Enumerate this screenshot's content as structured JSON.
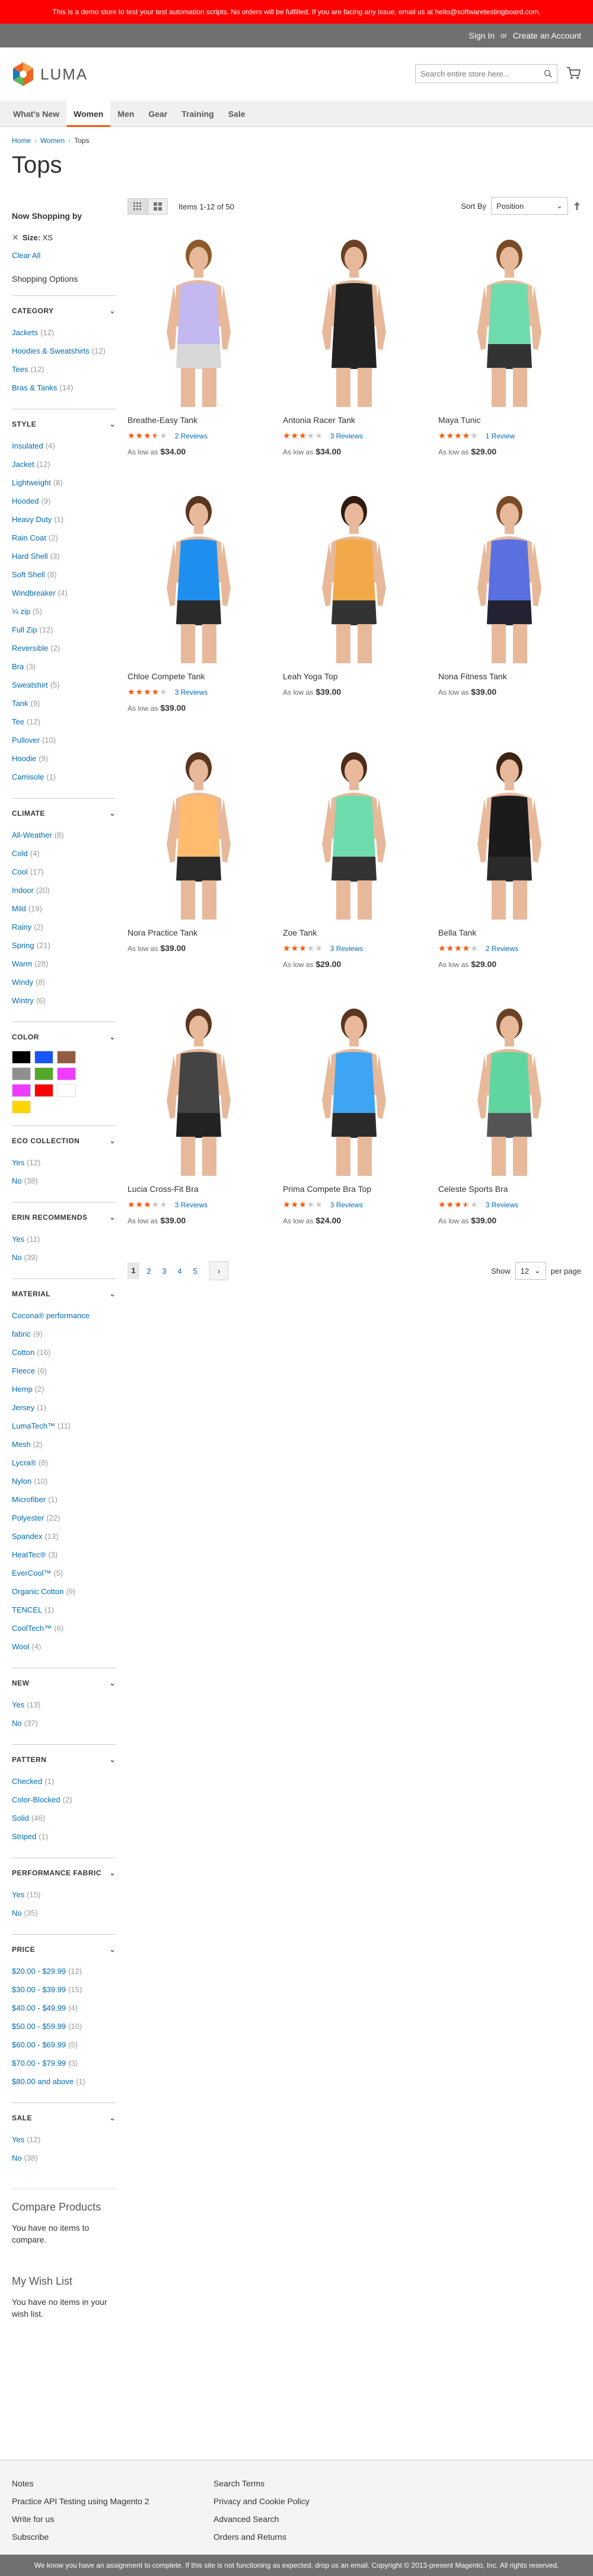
{
  "demo_notice": "This is a demo store to test your test automation scripts. No orders will be fulfilled. If you are facing any issue, email us at hello@softwaretestingboard.com.",
  "header_links": {
    "sign_in": "Sign In",
    "or": "or",
    "create_account": "Create an Account"
  },
  "logo_text": "LUMA",
  "search": {
    "placeholder": "Search entire store here..."
  },
  "nav": [
    "What's New",
    "Women",
    "Men",
    "Gear",
    "Training",
    "Sale"
  ],
  "breadcrumb": [
    "Home",
    "Women",
    "Tops"
  ],
  "page_title": "Tops",
  "now_shopping": {
    "title": "Now Shopping by",
    "filter_label": "Size:",
    "filter_value": "XS",
    "clear_all": "Clear All"
  },
  "shopping_options": "Shopping Options",
  "facets": [
    {
      "title": "CATEGORY",
      "items": [
        {
          "label": "Jackets",
          "count": "(12)"
        },
        {
          "label": "Hoodies & Sweatshirts",
          "count": "(12)"
        },
        {
          "label": "Tees",
          "count": "(12)"
        },
        {
          "label": "Bras & Tanks",
          "count": "(14)"
        }
      ]
    },
    {
      "title": "STYLE",
      "items": [
        {
          "label": "Insulated",
          "count": "(4)"
        },
        {
          "label": "Jacket",
          "count": "(12)"
        },
        {
          "label": "Lightweight",
          "count": "(8)"
        },
        {
          "label": "Hooded",
          "count": "(9)"
        },
        {
          "label": "Heavy Duty",
          "count": "(1)"
        },
        {
          "label": "Rain Coat",
          "count": "(2)"
        },
        {
          "label": "Hard Shell",
          "count": "(3)"
        },
        {
          "label": "Soft Shell",
          "count": "(8)"
        },
        {
          "label": "Windbreaker",
          "count": "(4)"
        },
        {
          "label": "¼ zip",
          "count": "(5)"
        },
        {
          "label": "Full Zip",
          "count": "(12)"
        },
        {
          "label": "Reversible",
          "count": "(2)"
        },
        {
          "label": "Bra",
          "count": "(3)"
        },
        {
          "label": "Sweatshirt",
          "count": "(5)"
        },
        {
          "label": "Tank",
          "count": "(9)"
        },
        {
          "label": "Tee",
          "count": "(12)"
        },
        {
          "label": "Pullover",
          "count": "(10)"
        },
        {
          "label": "Hoodie",
          "count": "(9)"
        },
        {
          "label": "Camisole",
          "count": "(1)"
        }
      ]
    },
    {
      "title": "CLIMATE",
      "items": [
        {
          "label": "All-Weather",
          "count": "(8)"
        },
        {
          "label": "Cold",
          "count": "(4)"
        },
        {
          "label": "Cool",
          "count": "(17)"
        },
        {
          "label": "Indoor",
          "count": "(20)"
        },
        {
          "label": "Mild",
          "count": "(19)"
        },
        {
          "label": "Rainy",
          "count": "(2)"
        },
        {
          "label": "Spring",
          "count": "(21)"
        },
        {
          "label": "Warm",
          "count": "(28)"
        },
        {
          "label": "Windy",
          "count": "(8)"
        },
        {
          "label": "Wintry",
          "count": "(6)"
        }
      ]
    }
  ],
  "color_facet": {
    "title": "COLOR",
    "swatches": [
      "#000000",
      "#1857f7",
      "#945c42",
      "#8f8f8f",
      "#53a828",
      "#ef3dff",
      "#ef3dff",
      "#ff0000",
      "#ffffff",
      "#ffd500"
    ]
  },
  "facets2": [
    {
      "title": "ECO COLLECTION",
      "items": [
        {
          "label": "Yes",
          "count": "(12)"
        },
        {
          "label": "No",
          "count": "(38)"
        }
      ]
    },
    {
      "title": "ERIN RECOMMENDS",
      "items": [
        {
          "label": "Yes",
          "count": "(11)"
        },
        {
          "label": "No",
          "count": "(39)"
        }
      ]
    },
    {
      "title": "MATERIAL",
      "items": [
        {
          "label": "Cocona® performance fabric",
          "count": "(9)"
        },
        {
          "label": "Cotton",
          "count": "(16)"
        },
        {
          "label": "Fleece",
          "count": "(6)"
        },
        {
          "label": "Hemp",
          "count": "(2)"
        },
        {
          "label": "Jersey",
          "count": "(1)"
        },
        {
          "label": "LumaTech™",
          "count": "(11)"
        },
        {
          "label": "Mesh",
          "count": "(2)"
        },
        {
          "label": "Lycra®",
          "count": "(8)"
        },
        {
          "label": "Nylon",
          "count": "(10)"
        },
        {
          "label": "Microfiber",
          "count": "(1)"
        },
        {
          "label": "Polyester",
          "count": "(22)"
        },
        {
          "label": "Spandex",
          "count": "(13)"
        },
        {
          "label": "HeatTec®",
          "count": "(3)"
        },
        {
          "label": "EverCool™",
          "count": "(5)"
        },
        {
          "label": "Organic Cotton",
          "count": "(9)"
        },
        {
          "label": "TENCEL",
          "count": "(1)"
        },
        {
          "label": "CoolTech™",
          "count": "(6)"
        },
        {
          "label": "Wool",
          "count": "(4)"
        }
      ]
    },
    {
      "title": "NEW",
      "items": [
        {
          "label": "Yes",
          "count": "(13)"
        },
        {
          "label": "No",
          "count": "(37)"
        }
      ]
    },
    {
      "title": "PATTERN",
      "items": [
        {
          "label": "Checked",
          "count": "(1)"
        },
        {
          "label": "Color-Blocked",
          "count": "(2)"
        },
        {
          "label": "Solid",
          "count": "(46)"
        },
        {
          "label": "Striped",
          "count": "(1)"
        }
      ]
    },
    {
      "title": "PERFORMANCE FABRIC",
      "items": [
        {
          "label": "Yes",
          "count": "(15)"
        },
        {
          "label": "No",
          "count": "(35)"
        }
      ]
    },
    {
      "title": "PRICE",
      "items": [
        {
          "label": "$20.00 - $29.99",
          "count": "(12)"
        },
        {
          "label": "$30.00 - $39.99",
          "count": "(15)"
        },
        {
          "label": "$40.00 - $49.99",
          "count": "(4)"
        },
        {
          "label": "$50.00 - $59.99",
          "count": "(10)"
        },
        {
          "label": "$60.00 - $69.99",
          "count": "(5)"
        },
        {
          "label": "$70.00 - $79.99",
          "count": "(3)"
        },
        {
          "label": "$80.00 and above",
          "count": "(1)"
        }
      ]
    },
    {
      "title": "SALE",
      "items": [
        {
          "label": "Yes",
          "count": "(12)"
        },
        {
          "label": "No",
          "count": "(38)"
        }
      ]
    }
  ],
  "compare": {
    "title": "Compare Products",
    "empty": "You have no items to compare."
  },
  "wishlist": {
    "title": "My Wish List",
    "empty": "You have no items in your wish list."
  },
  "toolbar": {
    "amount": "Items 1-12 of 50",
    "sort_label": "Sort By",
    "sort_value": "Position",
    "show_label": "Show",
    "limit_value": "12",
    "per_page": "per page"
  },
  "products": [
    {
      "name": "Breathe-Easy Tank",
      "rating": 0.7,
      "reviews": "2 Reviews",
      "price_label": "As low as",
      "price": "$34.00",
      "top": "#c4b8f0",
      "bottom": "#d8d8d8",
      "hair": "#8a5a2b"
    },
    {
      "name": "Antonia Racer Tank",
      "rating": 0.6,
      "reviews": "3 Reviews",
      "price_label": "As low as",
      "price": "$34.00",
      "top": "#222222",
      "bottom": "#222222",
      "hair": "#6b4226"
    },
    {
      "name": "Maya Tunic",
      "rating": 0.8,
      "reviews": "1 Review",
      "price_label": "As low as",
      "price": "$29.00",
      "top": "#6fdcae",
      "bottom": "#333333",
      "hair": "#7a4b26"
    },
    {
      "name": "Chloe Compete Tank",
      "rating": 0.8,
      "reviews": "3 Reviews",
      "price_label": "As low as",
      "price": "$39.00",
      "top": "#1f8ff0",
      "bottom": "#2a2a2a",
      "hair": "#5a3520"
    },
    {
      "name": "Leah Yoga Top",
      "rating": 0,
      "reviews": "",
      "price_label": "As low as",
      "price": "$39.00",
      "top": "#f2a94a",
      "bottom": "#333333",
      "hair": "#2c1b10"
    },
    {
      "name": "Nona Fitness Tank",
      "rating": 0,
      "reviews": "",
      "price_label": "As low as",
      "price": "$39.00",
      "top": "#5a6fe0",
      "bottom": "#222233",
      "hair": "#7a4b26"
    },
    {
      "name": "Nora Practice Tank",
      "rating": 0,
      "reviews": "",
      "price_label": "As low as",
      "price": "$39.00",
      "top": "#ffbb6e",
      "bottom": "#2a2a2a",
      "hair": "#5a3520"
    },
    {
      "name": "Zoe Tank",
      "rating": 0.6,
      "reviews": "3 Reviews",
      "price_label": "As low as",
      "price": "$29.00",
      "top": "#6fdcae",
      "bottom": "#333333",
      "hair": "#4a2c18"
    },
    {
      "name": "Bella Tank",
      "rating": 0.8,
      "reviews": "2 Reviews",
      "price_label": "As low as",
      "price": "$29.00",
      "top": "#1b1b1b",
      "bottom": "#2a2a2a",
      "hair": "#3b2414"
    },
    {
      "name": "Lucia Cross-Fit Bra",
      "rating": 0.6,
      "reviews": "3 Reviews",
      "price_label": "As low as",
      "price": "$39.00",
      "top": "#444444",
      "bottom": "#222222",
      "hair": "#5a3520"
    },
    {
      "name": "Prima Compete Bra Top",
      "rating": 0.6,
      "reviews": "3 Reviews",
      "price_label": "As low as",
      "price": "$24.00",
      "top": "#3ea5f5",
      "bottom": "#2a2a2a",
      "hair": "#5a3520"
    },
    {
      "name": "Celeste Sports Bra",
      "rating": 0.7,
      "reviews": "3 Reviews",
      "price_label": "As low as",
      "price": "$39.00",
      "top": "#5fd6a0",
      "bottom": "#555555",
      "hair": "#6b4226"
    }
  ],
  "pages": [
    "1",
    "2",
    "3",
    "4",
    "5"
  ],
  "footer": {
    "col1": [
      "Notes",
      "Practice API Testing using Magento 2",
      "Write for us",
      "Subscribe"
    ],
    "col2": [
      "Search Terms",
      "Privacy and Cookie Policy",
      "Advanced Search",
      "Orders and Returns"
    ]
  },
  "copyright": "We know you have an assignment to complete. If this site is not functioning as expected, drop us an email. Copyright © 2013-present Magento, Inc. All rights reserved."
}
